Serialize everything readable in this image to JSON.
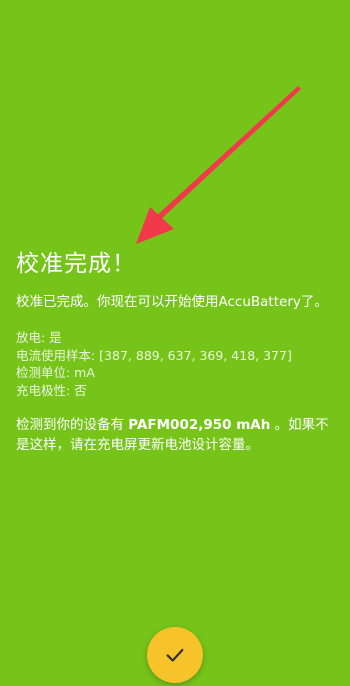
{
  "title": "校准完成！",
  "intro": "校准已完成。你现在可以开始使用AccuBattery了。",
  "details": {
    "discharge": "放电: 是",
    "samples": "电流使用样本: [387, 889, 637, 369, 418, 377]",
    "unit": "检测单位: mA",
    "polarity": "充电极性: 否"
  },
  "capacity": {
    "prefix": "检测到你的设备有 ",
    "value": "PAFM002,950 mAh",
    "suffix": " 。如果不是这样，请在充电屏更新电池设计容量。"
  },
  "fab_icon": "check-icon",
  "colors": {
    "background": "#76c41a",
    "fab": "#f7c32a",
    "arrow": "#f2384b"
  }
}
